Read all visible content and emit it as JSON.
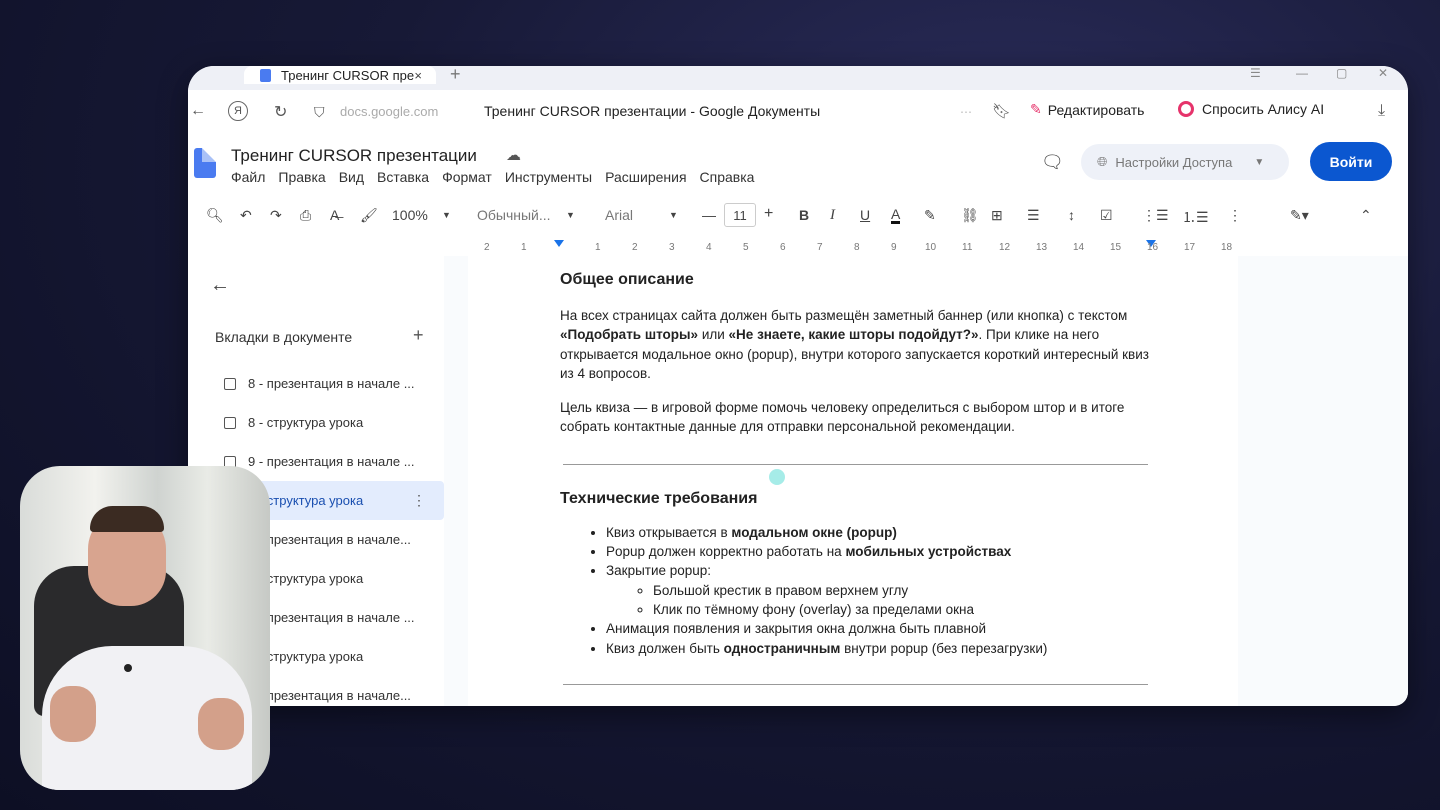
{
  "browser": {
    "tab_title": "Тренинг CURSOR пре",
    "tab_close": "×",
    "new_tab": "+",
    "url": "docs.google.com",
    "page_title": "Тренинг CURSOR презентации - Google Документы",
    "edit_label": "Редактировать",
    "alice_label": "Спросить Алису AI"
  },
  "doc_header": {
    "title": "Тренинг CURSOR презентации",
    "menu": [
      "Файл",
      "Правка",
      "Вид",
      "Вставка",
      "Формат",
      "Инструменты",
      "Расширения",
      "Справка"
    ],
    "share_label": "Настройки Доступа",
    "login_label": "Войти"
  },
  "toolbar": {
    "zoom": "100%",
    "style": "Обычный...",
    "font": "Arial",
    "font_size": "11",
    "bold": "B",
    "italic": "I",
    "underline": "U",
    "text_color": "A"
  },
  "ruler": [
    "2",
    "1",
    "1",
    "2",
    "3",
    "4",
    "5",
    "6",
    "7",
    "8",
    "9",
    "10",
    "11",
    "12",
    "13",
    "14",
    "15",
    "16",
    "17",
    "18"
  ],
  "sidebar": {
    "heading": "Вкладки в документе",
    "items": [
      {
        "label": "8 - презентация в начале ..."
      },
      {
        "label": "8 - структура урока"
      },
      {
        "label": "9 - презентация в начале ..."
      },
      {
        "label": "9 - структура урока"
      },
      {
        "label": "0 - презентация в начале..."
      },
      {
        "label": "0 - структура урока"
      },
      {
        "label": "1 - презентация в начале ..."
      },
      {
        "label": "1 - структура урока"
      },
      {
        "label": "2 - презентация в начале..."
      }
    ]
  },
  "doc": {
    "h1": "Общее описание",
    "p1_a": "На всех страницах сайта должен быть размещён заметный баннер (или кнопка) с текстом ",
    "p1_b": "«Подобрать шторы»",
    "p1_c": " или ",
    "p1_d": "«Не знаете, какие шторы подойдут?»",
    "p1_e": ". При клике на него открывается модальное окно (popup), внутри которого запускается короткий интересный квиз из 4 вопросов.",
    "p2": "Цель квиза — в игровой форме помочь человеку определиться с выбором штор и в итоге собрать контактные данные для отправки персональной рекомендации.",
    "h2": "Технические требования",
    "li1_a": "Квиз открывается в ",
    "li1_b": "модальном окне (popup)",
    "li2_a": "Popup должен корректно работать на ",
    "li2_b": "мобильных устройствах",
    "li3": "Закрытие popup:",
    "li3_1": "Большой крестик в правом верхнем углу",
    "li3_2": "Клик по тёмному фону (overlay) за пределами окна",
    "li4": "Анимация появления и закрытия окна должна быть плавной",
    "li5_a": "Квиз должен быть ",
    "li5_b": "одностраничным",
    "li5_c": " внутри popup (без перезагрузки)"
  }
}
